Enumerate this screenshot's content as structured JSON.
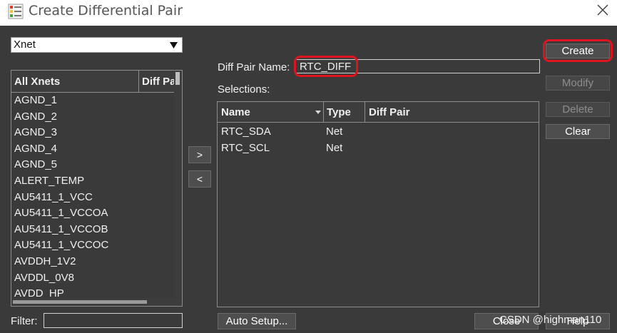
{
  "window": {
    "title": "Create Differential Pair",
    "close_icon": "close-icon",
    "app_icon": "app-icon"
  },
  "object_type": {
    "selected": "Xnet"
  },
  "left_list": {
    "headers": [
      "All Xnets",
      "Diff Pair"
    ],
    "items": [
      "AGND_1",
      "AGND_2",
      "AGND_3",
      "AGND_4",
      "AGND_5",
      "ALERT_TEMP",
      "AU5411_1_VCC",
      "AU5411_1_VCCOA",
      "AU5411_1_VCCOB",
      "AU5411_1_VCCOC",
      "AVDDH_1V2",
      "AVDDL_0V8",
      "AVDD_HP"
    ]
  },
  "filter": {
    "label": "Filter:",
    "value": ""
  },
  "move_buttons": {
    "add": ">",
    "remove": "<"
  },
  "diff_pair": {
    "label": "Diff Pair Name:",
    "value": "RTC_DIFF"
  },
  "selections": {
    "label": "Selections:",
    "headers": {
      "name": "Name",
      "type": "Type",
      "diff_pair": "Diff Pair"
    },
    "rows": [
      {
        "name": "RTC_SDA",
        "type": "Net",
        "diff_pair": ""
      },
      {
        "name": "RTC_SCL",
        "type": "Net",
        "diff_pair": ""
      }
    ]
  },
  "buttons": {
    "create": "Create",
    "modify": "Modify",
    "delete": "Delete",
    "clear": "Clear",
    "auto_setup": "Auto Setup...",
    "close": "Close",
    "help": "Help"
  },
  "watermark": "CSDN @highman110",
  "colors": {
    "background": "#3a3a3a",
    "highlight": "#e0141e",
    "titlebar": "#ffffff"
  }
}
